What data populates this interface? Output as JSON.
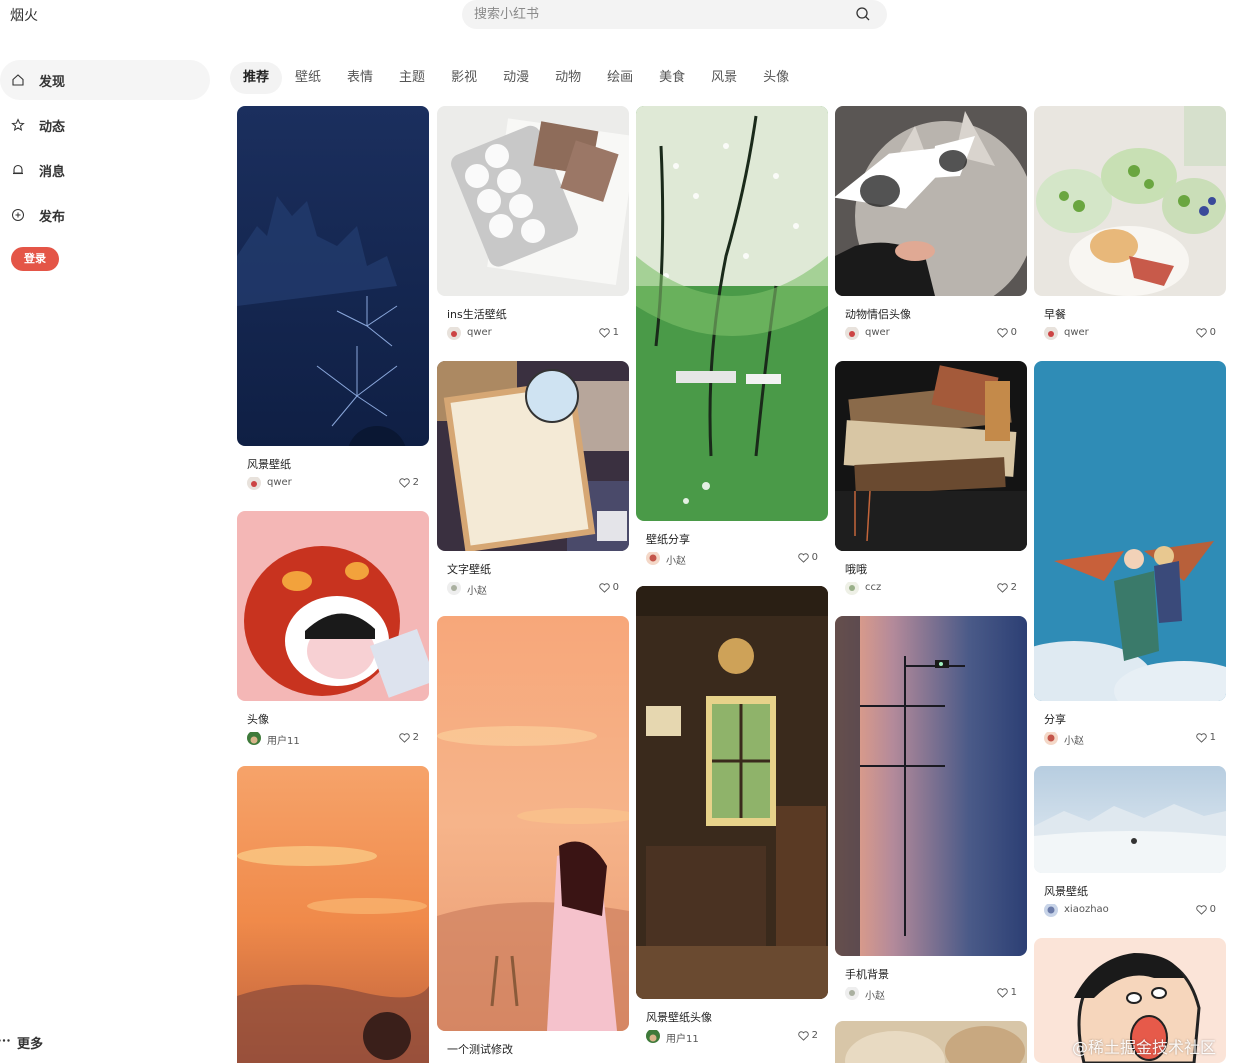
{
  "brand": "烟火",
  "search": {
    "placeholder": "搜索小红书"
  },
  "sidebar": {
    "items": [
      {
        "label": "发现",
        "icon": "home-icon"
      },
      {
        "label": "动态",
        "icon": "star-icon"
      },
      {
        "label": "消息",
        "icon": "bell-icon"
      },
      {
        "label": "发布",
        "icon": "plus-circle-icon"
      }
    ],
    "login_label": "登录",
    "more_label": "更多"
  },
  "tabs": [
    "推荐",
    "壁纸",
    "表情",
    "主题",
    "影视",
    "动漫",
    "动物",
    "绘画",
    "美食",
    "风景",
    "头像"
  ],
  "accent_color": "#e45547",
  "cards": [
    {
      "title": "风景壁纸",
      "author": "qwer",
      "likes": "2"
    },
    {
      "title": "头像",
      "author": "用户11",
      "likes": "2"
    },
    {
      "title": "",
      "author": "",
      "likes": ""
    },
    {
      "title": "ins生活壁纸",
      "author": "qwer",
      "likes": "1"
    },
    {
      "title": "文字壁纸",
      "author": "小赵",
      "likes": "0"
    },
    {
      "title": "一个测试修改",
      "author": "",
      "likes": ""
    },
    {
      "title": "壁纸分享",
      "author": "小赵",
      "likes": "0"
    },
    {
      "title": "风景壁纸头像",
      "author": "用户11",
      "likes": "2"
    },
    {
      "title": "动物情侣头像",
      "author": "qwer",
      "likes": "0"
    },
    {
      "title": "哦哦",
      "author": "ccz",
      "likes": "2"
    },
    {
      "title": "手机背景",
      "author": "小赵",
      "likes": "1"
    },
    {
      "title": "",
      "author": "",
      "likes": ""
    },
    {
      "title": "早餐",
      "author": "qwer",
      "likes": "0"
    },
    {
      "title": "分享",
      "author": "小赵",
      "likes": "1"
    },
    {
      "title": "风景壁纸",
      "author": "xiaozhao",
      "likes": "0"
    },
    {
      "title": "",
      "author": "",
      "likes": ""
    }
  ],
  "watermark": "@稀土掘金技术社区"
}
